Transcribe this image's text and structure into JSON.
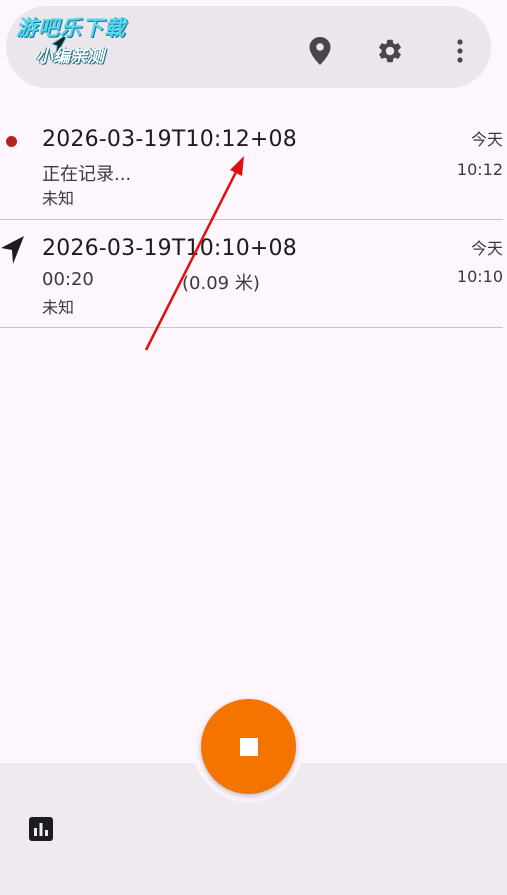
{
  "watermark": {
    "line1": "游吧乐下载",
    "line2": "小编亲测"
  },
  "toolbar": {
    "icons": [
      "location-pin-icon",
      "gear-icon",
      "more-vert-icon"
    ]
  },
  "tracks": [
    {
      "title": "2026-03-19T10:12+08",
      "status": "正在记录...",
      "activity": "未知",
      "date": "今天",
      "time": "10:12",
      "icon": "recording-dot-icon"
    },
    {
      "title": "2026-03-19T10:10+08",
      "duration": "00:20",
      "distance": "(0.09 米)",
      "activity": "未知",
      "date": "今天",
      "time": "10:10",
      "icon": "navigation-arrow-icon"
    }
  ],
  "fab": {
    "icon": "stop-icon"
  },
  "bottom": {
    "icon": "bar-chart-icon"
  },
  "colors": {
    "accent": "#f57400",
    "recording": "#b3261e",
    "annotation": "#e01010"
  }
}
